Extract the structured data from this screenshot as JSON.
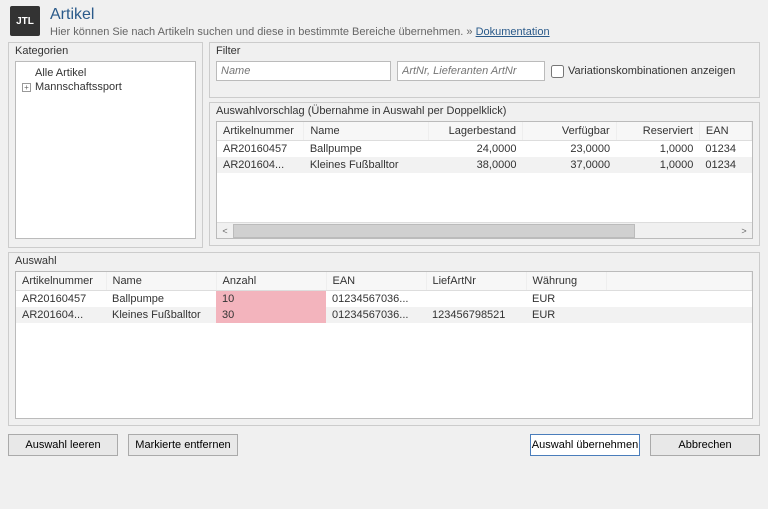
{
  "header": {
    "title": "Artikel",
    "subtitle": "Hier können Sie nach Artikeln suchen und diese in bestimmte Bereiche übernehmen.  »",
    "doc_link": "Dokumentation",
    "logo_text": "JTL"
  },
  "categories": {
    "title": "Kategorien",
    "root": "Alle Artikel",
    "child1": "Mannschaftssport"
  },
  "filter": {
    "title": "Filter",
    "name_placeholder": "Name",
    "art_placeholder": "ArtNr, Lieferanten ArtNr",
    "variations_label": "Variationskombinationen anzeigen"
  },
  "suggest": {
    "title": "Auswahlvorschlag (Übernahme in Auswahl per Doppelklick)",
    "cols": {
      "artnr": "Artikelnummer",
      "name": "Name",
      "stock": "Lagerbestand",
      "avail": "Verfügbar",
      "reserved": "Reserviert",
      "ean": "EAN"
    },
    "rows": [
      {
        "artnr": "AR20160457",
        "name": "Ballpumpe",
        "stock": "24,0000",
        "avail": "23,0000",
        "reserved": "1,0000",
        "ean": "01234"
      },
      {
        "artnr": "AR201604...",
        "name": "Kleines Fußballtor",
        "stock": "38,0000",
        "avail": "37,0000",
        "reserved": "1,0000",
        "ean": "01234"
      }
    ]
  },
  "selection": {
    "title": "Auswahl",
    "cols": {
      "artnr": "Artikelnummer",
      "name": "Name",
      "qty": "Anzahl",
      "ean": "EAN",
      "liefart": "LiefArtNr",
      "currency": "Währung"
    },
    "rows": [
      {
        "artnr": "AR20160457",
        "name": "Ballpumpe",
        "qty": "10",
        "ean": "01234567036...",
        "liefart": "",
        "currency": "EUR"
      },
      {
        "artnr": "AR201604...",
        "name": "Kleines Fußballtor",
        "qty": "30",
        "ean": "01234567036...",
        "liefart": "123456798521",
        "currency": "EUR"
      }
    ]
  },
  "buttons": {
    "clear": "Auswahl leeren",
    "remove": "Markierte entfernen",
    "apply": "Auswahl übernehmen",
    "cancel": "Abbrechen"
  }
}
